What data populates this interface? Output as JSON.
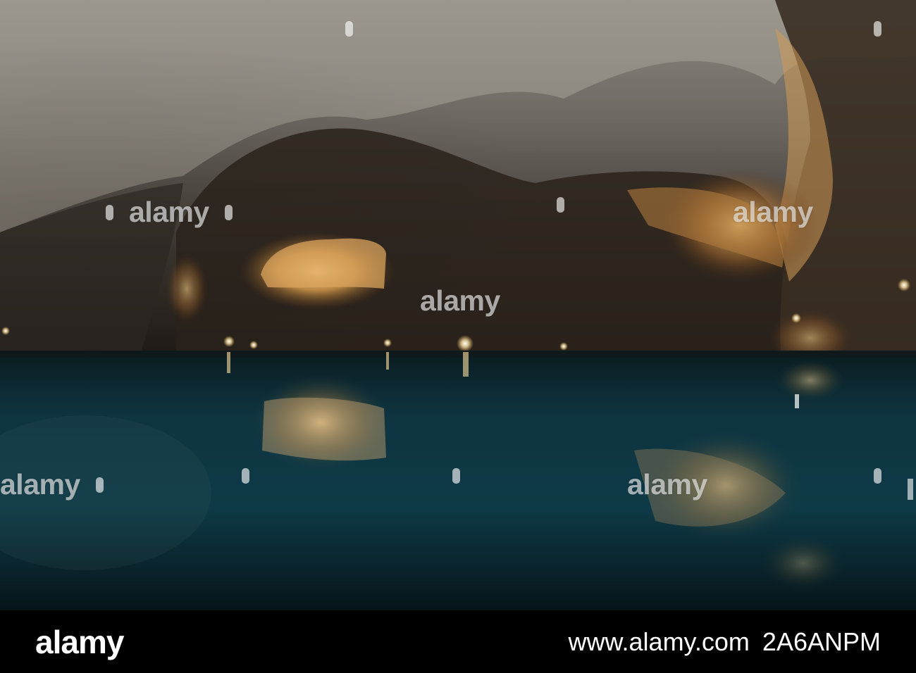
{
  "image": {
    "subject": "underground cave lake",
    "colors": {
      "rock_light": "#a39e93",
      "rock_dark": "#3b3128",
      "lamp_glow": "#f2c87a",
      "water": "#0d3a45",
      "footer_bg": "#000000"
    }
  },
  "watermark": {
    "text": "alamy"
  },
  "footer": {
    "logo": "alamy",
    "id_label": "www.alamy.com",
    "id_value": "2A6ANPM"
  }
}
